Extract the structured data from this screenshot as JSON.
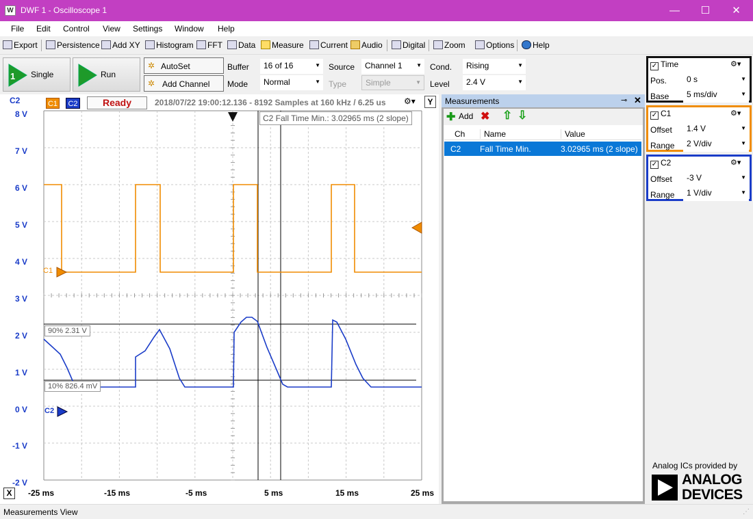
{
  "window": {
    "title": "DWF 1 - Oscilloscope 1",
    "app_icon": "waveforms-icon",
    "minimize": "—",
    "maximize": "☐",
    "close": "✕"
  },
  "menu": [
    "File",
    "Edit",
    "Control",
    "View",
    "Settings",
    "Window",
    "Help"
  ],
  "toolbar": {
    "export": "Export",
    "persistence": "Persistence",
    "addxy": "Add XY",
    "histogram": "Histogram",
    "fft": "FFT",
    "data": "Data",
    "measure": "Measure",
    "current": "Current",
    "audio": "Audio",
    "digital": "Digital",
    "zoom": "Zoom",
    "options": "Options",
    "help": "Help"
  },
  "controls": {
    "single": "Single",
    "run": "Run",
    "autoset": "AutoSet",
    "add_channel": "Add Channel",
    "buffer_label": "Buffer",
    "buffer_value": "16 of 16",
    "mode_label": "Mode",
    "mode_value": "Normal",
    "source_label": "Source",
    "source_value": "Channel 1",
    "type_label": "Type",
    "type_value": "Simple",
    "cond_label": "Cond.",
    "cond_value": "Rising",
    "level_label": "Level",
    "level_value": "2.4 V"
  },
  "plot": {
    "axis_channel": "C2",
    "c1_tag": "C1",
    "c2_tag": "C2",
    "status": "Ready",
    "info": "2018/07/22 19:00:12.136 - 8192 Samples at 160 kHz / 6.25 us",
    "measure_label": "C2 Fall Time Min.: 3.02965 ms (2 slope)",
    "y_button": "Y",
    "close_x": "X",
    "ref_high": "90% 2.31 V",
    "ref_low": "10% 826.4 mV",
    "y_ticks": [
      "8 V",
      "7 V",
      "6 V",
      "5 V",
      "4 V",
      "3 V",
      "2 V",
      "1 V",
      "0 V",
      "-1 V",
      "-2 V"
    ],
    "x_ticks": [
      "-25 ms",
      "-15 ms",
      "-5 ms",
      "5 ms",
      "15 ms",
      "25 ms"
    ],
    "c1_color": "#f08c00",
    "c2_color": "#1a3cc8"
  },
  "measurements": {
    "title": "Measurements",
    "add": "Add",
    "columns": [
      "Ch",
      "Name",
      "Value"
    ],
    "rows": [
      {
        "ch": "C2",
        "name": "Fall Time Min.",
        "value": "3.02965 ms (2 slope)"
      }
    ]
  },
  "time_panel": {
    "title": "Time",
    "pos_label": "Pos.",
    "pos_value": "0 s",
    "base_label": "Base",
    "base_value": "5 ms/div"
  },
  "c1_panel": {
    "title": "C1",
    "offset_label": "Offset",
    "offset_value": "1.4 V",
    "range_label": "Range",
    "range_value": "2 V/div",
    "border": "#f08c00"
  },
  "c2_panel": {
    "title": "C2",
    "offset_label": "Offset",
    "offset_value": "-3 V",
    "range_label": "Range",
    "range_value": "1 V/div",
    "border": "#1a3cc8"
  },
  "branding": {
    "line1": "Analog ICs provided by",
    "line2": "ANALOG",
    "line3": "DEVICES"
  },
  "status_bar": "Measurements View"
}
